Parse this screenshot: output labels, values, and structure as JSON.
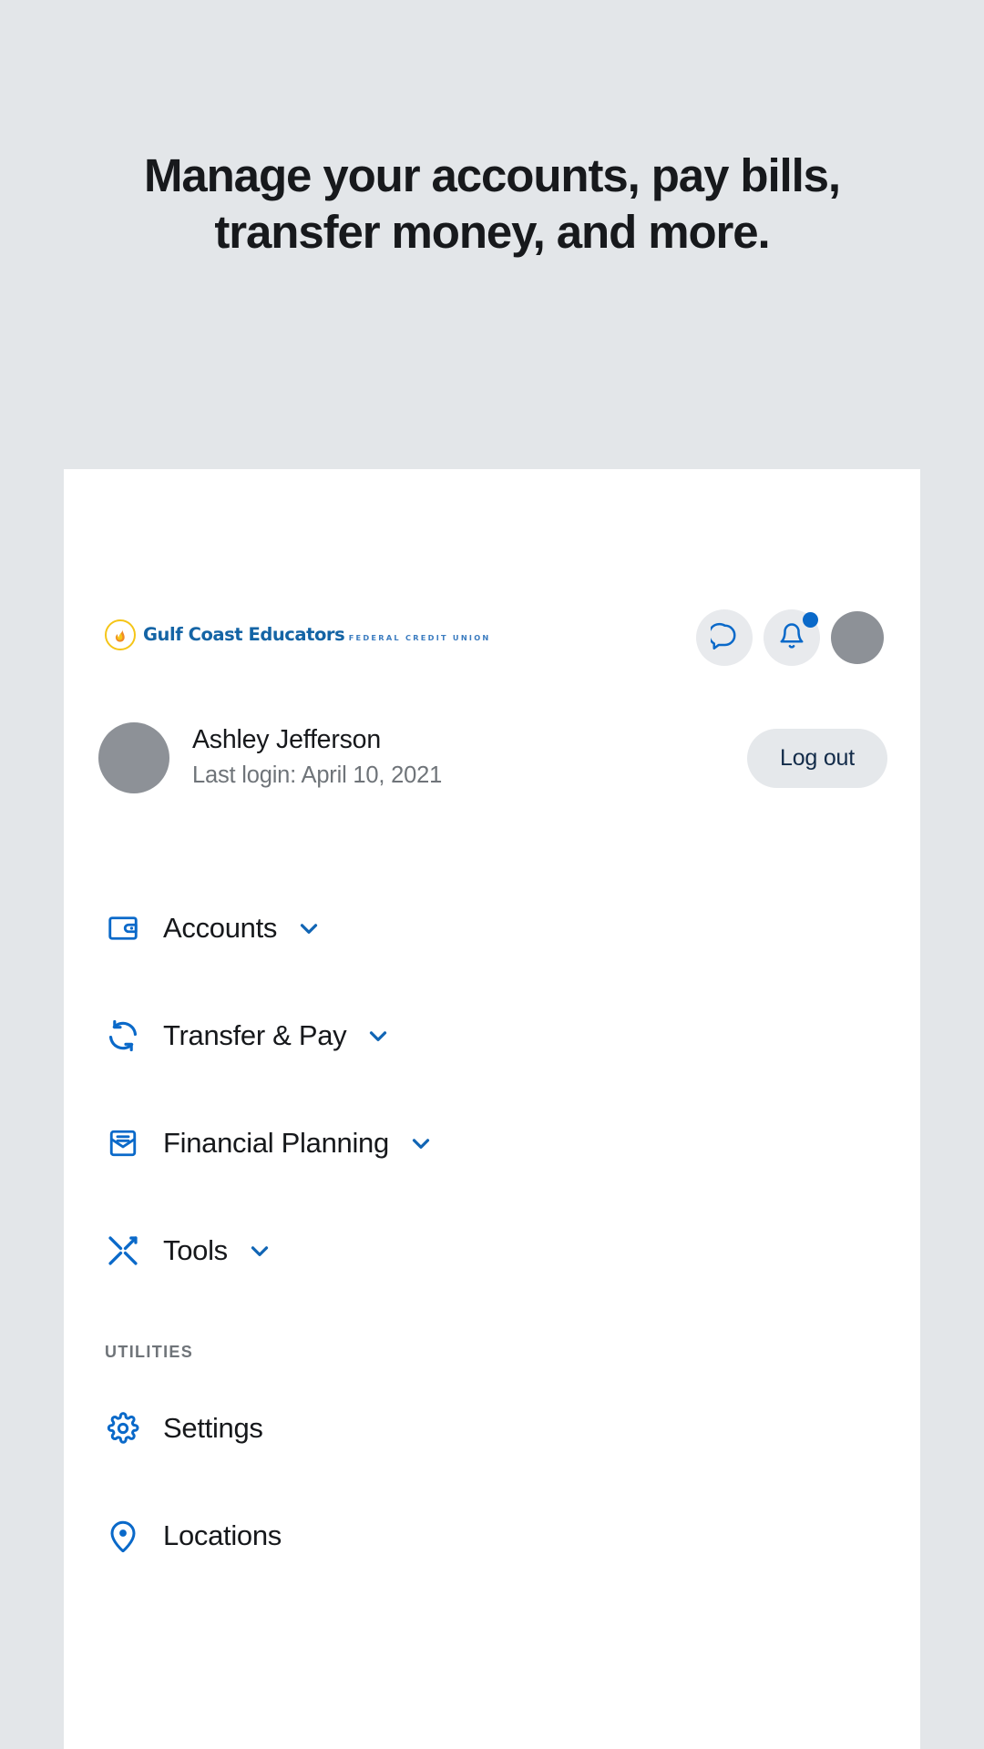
{
  "promo": {
    "heading_line1": "Manage your accounts, pay bills,",
    "heading_line2": "transfer money, and more."
  },
  "app": {
    "brand": {
      "name": "Gulf Coast Educators",
      "subtitle": "FEDERAL CREDIT UNION",
      "mark_icon": "flame-icon"
    },
    "topbar": {
      "messages_icon": "chat-bubble-icon",
      "notifications_icon": "bell-icon",
      "avatar_icon": "user-avatar",
      "has_notification": true
    },
    "profile": {
      "name": "Ashley Jefferson",
      "last_login": "Last login: April 10, 2021",
      "logout_label": "Log out"
    },
    "nav": [
      {
        "label": "Accounts",
        "icon": "wallet-icon",
        "expandable": true
      },
      {
        "label": "Transfer & Pay",
        "icon": "transfer-icon",
        "expandable": true
      },
      {
        "label": "Financial Planning",
        "icon": "envelope-icon",
        "expandable": true
      },
      {
        "label": "Tools",
        "icon": "tools-icon",
        "expandable": true
      }
    ],
    "utilities_label": "UTILITIES",
    "utilities": [
      {
        "label": "Settings",
        "icon": "gear-icon",
        "expandable": false
      },
      {
        "label": "Locations",
        "icon": "map-pin-icon",
        "expandable": false
      }
    ]
  },
  "colors": {
    "page_background": "#e3e6e9",
    "card_background": "#ffffff",
    "brand_blue": "#1464a5",
    "icon_blue": "#0a69c9",
    "brand_yellow": "#f5c518",
    "text_primary": "#16181b",
    "text_muted": "#6f7479",
    "chip_grey": "#e8eaed"
  }
}
